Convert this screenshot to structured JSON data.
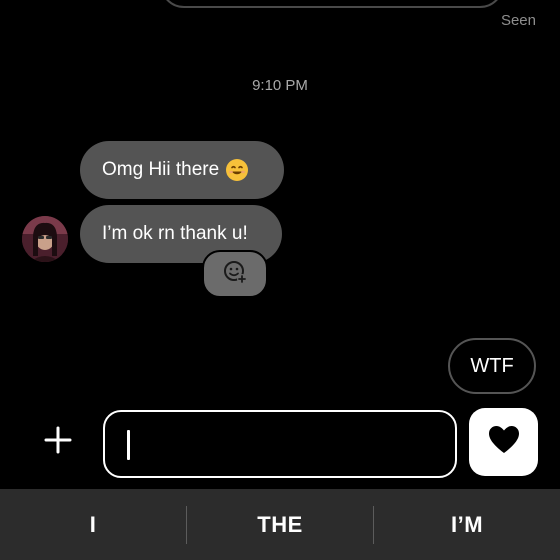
{
  "status": {
    "seen_label": "Seen"
  },
  "conversation": {
    "timestamp": "9:10 PM",
    "messages": [
      {
        "text": "Omg Hii there",
        "emoji": "smiling-face-emoji"
      },
      {
        "text": "I’m ok rn thank u!"
      }
    ],
    "react_button_icon": "add-reaction-icon"
  },
  "quick_reply": {
    "label": "WTF"
  },
  "composer": {
    "plus_icon": "plus-icon",
    "value": "",
    "like_icon": "heart-icon"
  },
  "keyboard": {
    "suggestions": [
      "I",
      "THE",
      "I’M"
    ]
  },
  "colors": {
    "background": "#000000",
    "bubble": "#545454",
    "suggestion_bar": "#2c2c2c",
    "emoji_yellow": "#f7c13a"
  }
}
